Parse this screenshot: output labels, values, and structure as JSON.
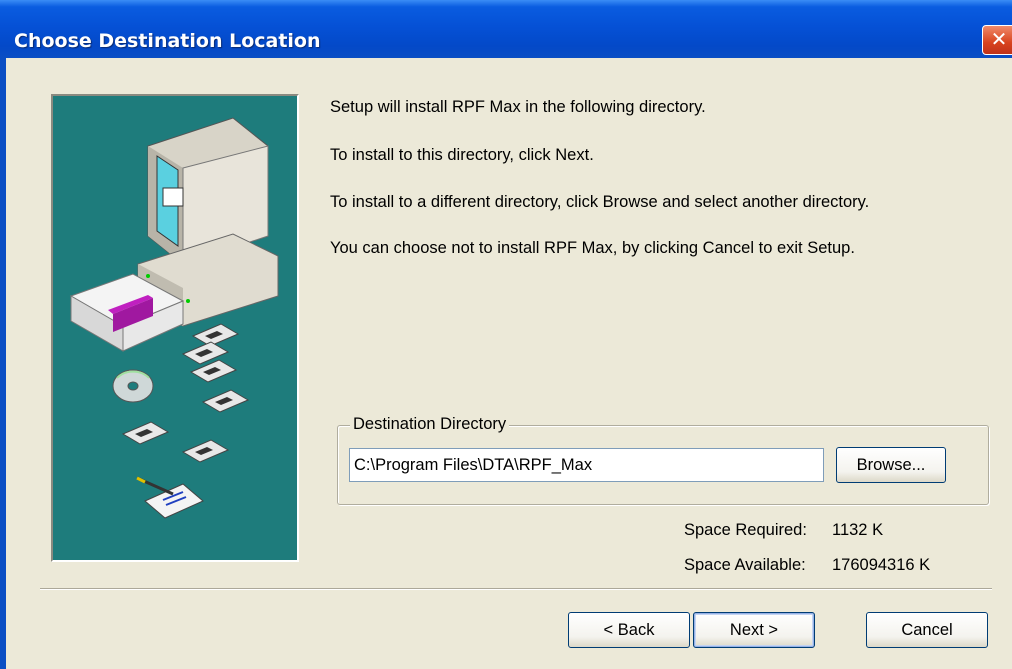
{
  "window": {
    "title": "Choose Destination Location",
    "close_glyph": "✕"
  },
  "messages": [
    "Setup will install RPF Max in the following directory.",
    "To install to this directory, click Next.",
    "To install to a different directory, click Browse and select another directory.",
    "You can choose not to install RPF Max, by clicking Cancel to exit Setup."
  ],
  "destination": {
    "group_label": "Destination Directory",
    "path": "C:\\Program Files\\DTA\\RPF_Max",
    "browse_label": "Browse..."
  },
  "space": {
    "required_label": "Space Required:",
    "required_value": "1132 K",
    "available_label": "Space Available:",
    "available_value": "176094316 K"
  },
  "buttons": {
    "back": "< Back",
    "next": "Next >",
    "cancel": "Cancel"
  },
  "illustration": {
    "icon": "installer-illustration-icon",
    "background_color": "#1e7c7c"
  }
}
